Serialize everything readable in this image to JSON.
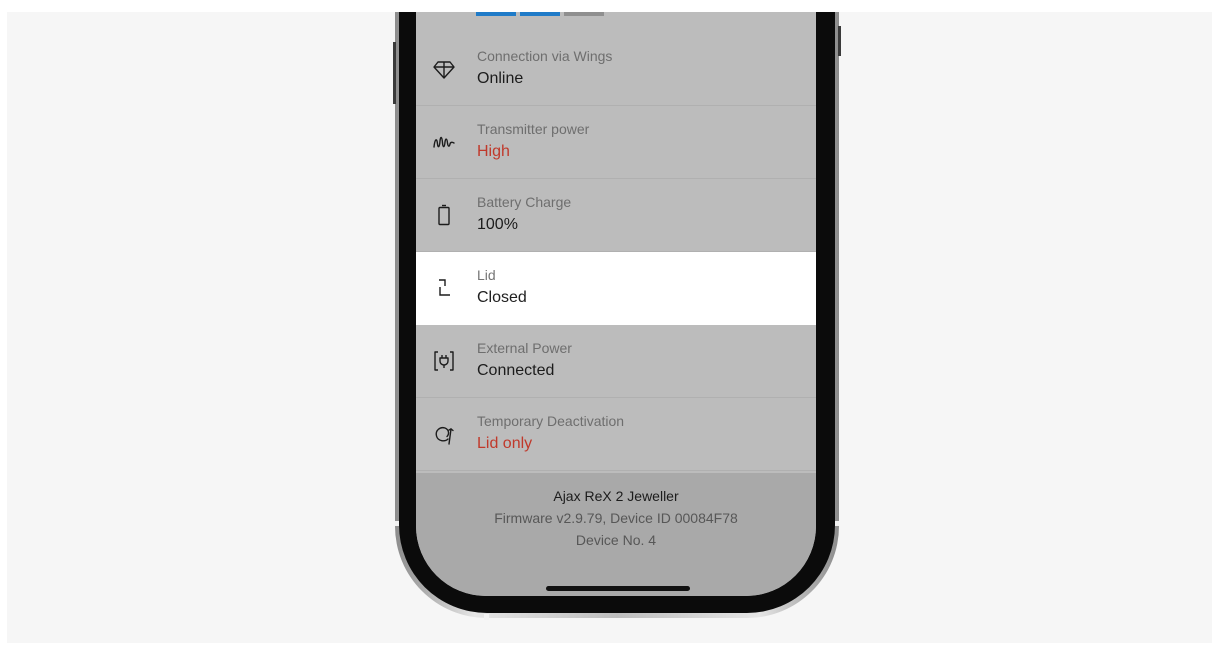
{
  "colors": {
    "tab_active": "#1f7bc8",
    "tab_inactive": "#8f8f8f",
    "alert_text": "#c0392b",
    "row_highlight": "#ffffff"
  },
  "rows": [
    {
      "icon": "wings-diamond-icon",
      "label": "Connection via Wings",
      "value": "Online",
      "status": "normal"
    },
    {
      "icon": "signal-wave-icon",
      "label": "Transmitter power",
      "value": "High",
      "status": "alert"
    },
    {
      "icon": "battery-icon",
      "label": "Battery Charge",
      "value": "100%",
      "status": "normal"
    },
    {
      "icon": "lid-icon",
      "label": "Lid",
      "value": "Closed",
      "status": "highlighted"
    },
    {
      "icon": "power-plug-icon",
      "label": "External Power",
      "value": "Connected",
      "status": "normal"
    },
    {
      "icon": "deactivation-icon",
      "label": "Temporary Deactivation",
      "value": "Lid only",
      "status": "alert"
    }
  ],
  "footer": {
    "device_name": "Ajax ReX 2 Jeweller",
    "device_info": "Firmware v2.9.79, Device ID 00084F78",
    "device_no": "Device No. 4"
  }
}
